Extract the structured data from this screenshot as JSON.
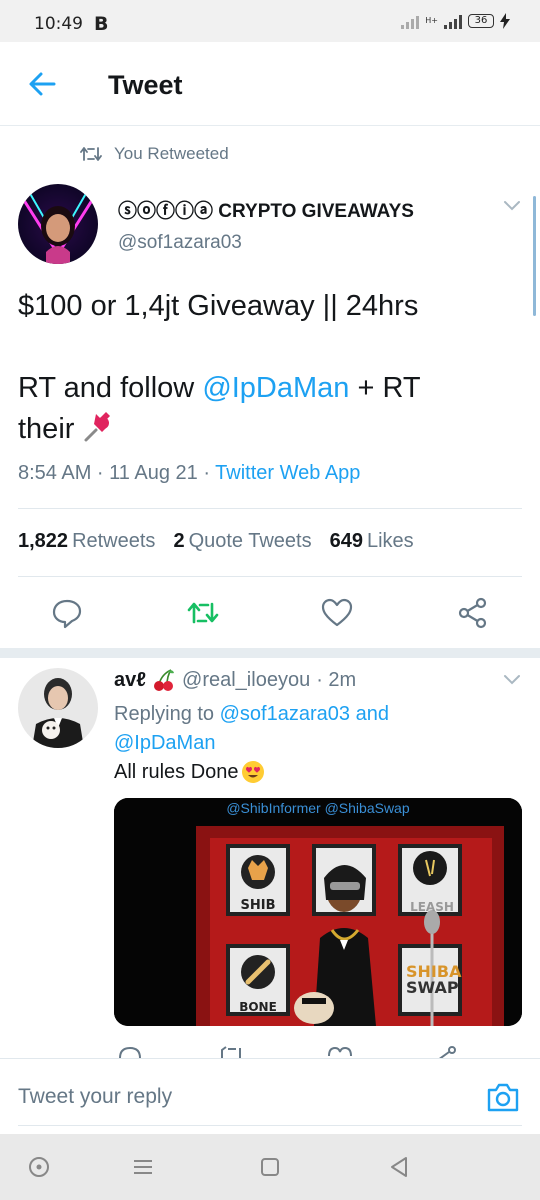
{
  "status_bar": {
    "time": "10:49",
    "notification_letter": "B",
    "network_label": "H+",
    "battery": "36"
  },
  "header": {
    "title": "Tweet",
    "back_icon": "arrow-left-icon"
  },
  "retweet_context": {
    "label": "You Retweeted",
    "icon": "retweet-icon"
  },
  "tweet": {
    "author_name": "ⓢⓞⓕⓘⓐ CRYPTO GIVEAWAYS",
    "author_handle": "@sof1azara03",
    "text_line1": "$100 or 1,4jt  Giveaway || 24hrs",
    "text_line2_prefix": "RT and follow ",
    "text_line2_mention": "@IpDaMan",
    "text_line2_suffix": " + RT",
    "text_line3": "their",
    "pin_icon": "pushpin-emoji",
    "timestamp": "8:54 AM · 11 Aug 21 · ",
    "source": "Twitter Web App",
    "stats": {
      "retweets_count": "1,822",
      "retweets_label": "Retweets",
      "quotes_count": "2",
      "quotes_label": "Quote Tweets",
      "likes_count": "649",
      "likes_label": "Likes"
    },
    "accent_color": "#1da1f2",
    "retweet_active_color": "#17bf63"
  },
  "reply": {
    "name": "avℓ",
    "handle": "@real_iloeyou",
    "time": " · 2m",
    "replying_prefix": "Replying to ",
    "replying_mention1": "@sof1azara03",
    "replying_and": " and",
    "replying_mention2": "@IpDaMan",
    "text": "All rules Done",
    "media_caption": "@ShibInformer @ShibaSwap",
    "media_tiles": [
      "SHIB",
      "LEASH",
      "BONE",
      "SHIBA",
      "SWAP"
    ]
  },
  "compose": {
    "placeholder": "Tweet your reply",
    "camera_icon": "camera-icon"
  },
  "nav_bar": {
    "icons": [
      "assistant-dot-icon",
      "menu-lines-icon",
      "home-square-icon",
      "back-triangle-icon"
    ]
  }
}
